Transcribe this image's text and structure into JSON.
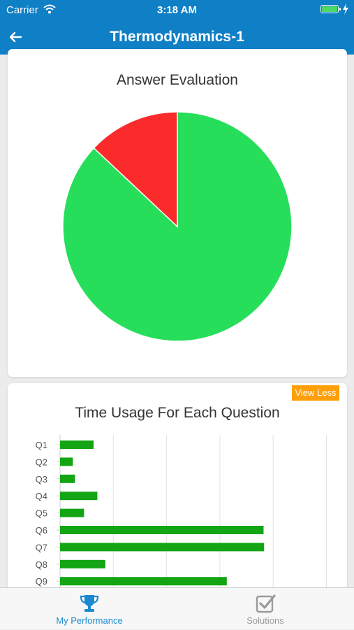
{
  "status_bar": {
    "carrier": "Carrier",
    "time": "3:18 AM"
  },
  "nav": {
    "title": "Thermodynamics-1",
    "back_icon": "back-arrow-icon"
  },
  "colors": {
    "nav_bg": "#0f7fc6",
    "correct": "#27de5b",
    "wrong": "#fb2b2b",
    "bar": "#13a513",
    "view_less": "#ff9f0a",
    "tab_active": "#1a8ad0",
    "tab_inactive": "#9a9a9a"
  },
  "answer_card": {
    "title": "Answer Evaluation"
  },
  "time_card": {
    "title": "Time Usage For Each Question",
    "toggle_label": "View Less"
  },
  "chart_data": [
    {
      "type": "pie",
      "title": "Answer Evaluation",
      "slices": [
        {
          "value": 87,
          "color": "#27de5b"
        },
        {
          "value": 13,
          "color": "#fb2b2b"
        }
      ]
    },
    {
      "type": "bar",
      "orientation": "horizontal",
      "title": "Time Usage For Each Question",
      "categories": [
        "Q1",
        "Q2",
        "Q3",
        "Q4",
        "Q5",
        "Q6",
        "Q7",
        "Q8",
        "Q9"
      ],
      "values": [
        63,
        24,
        28,
        70,
        45,
        382,
        383,
        85,
        313
      ],
      "xlim": [
        0,
        500
      ],
      "grid": true
    }
  ],
  "tabs": [
    {
      "label": "My Performance",
      "icon": "trophy-icon",
      "active": true
    },
    {
      "label": "Solutions",
      "icon": "checkbox-icon",
      "active": false
    }
  ]
}
